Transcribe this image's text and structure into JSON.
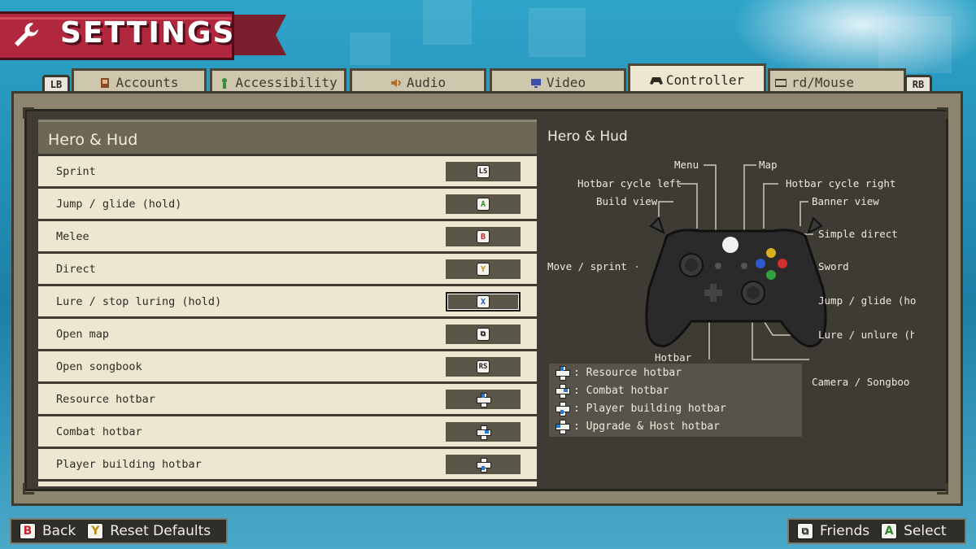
{
  "header": {
    "title": "SETTINGS"
  },
  "tabs": {
    "left_bumper": "LB",
    "right_bumper": "RB",
    "items": [
      {
        "label": "Accounts",
        "icon": "user-icon"
      },
      {
        "label": "Accessibility",
        "icon": "figure-icon"
      },
      {
        "label": "Audio",
        "icon": "speaker-icon"
      },
      {
        "label": "Video",
        "icon": "monitor-icon"
      },
      {
        "label": "Controller",
        "icon": "gamepad-icon",
        "active": true
      },
      {
        "label": "rd/Mouse",
        "icon": "keyboard-icon"
      }
    ]
  },
  "list": {
    "section_title": "Hero & Hud",
    "rows": [
      {
        "label": "Sprint",
        "key": "LS"
      },
      {
        "label": "Jump / glide (hold)",
        "key": "A"
      },
      {
        "label": "Melee",
        "key": "B"
      },
      {
        "label": "Direct",
        "key": "Y"
      },
      {
        "label": "Lure / stop luring (hold)",
        "key": "X",
        "selected": true
      },
      {
        "label": "Open map",
        "key": "view"
      },
      {
        "label": "Open songbook",
        "key": "RS"
      },
      {
        "label": "Resource hotbar",
        "key": "dpad-up"
      },
      {
        "label": "Combat hotbar",
        "key": "dpad-right"
      },
      {
        "label": "Player building hotbar",
        "key": "dpad-down"
      }
    ]
  },
  "diagram": {
    "title": "Hero & Hud",
    "labels": {
      "menu": "Menu",
      "map": "Map",
      "hotbar_left": "Hotbar cycle left",
      "hotbar_right": "Hotbar cycle right",
      "build_view": "Build view",
      "banner_view": "Banner view",
      "simple_direct": "Simple direct",
      "move": "Move / sprint (",
      "sword": "Sword",
      "jump": "Jump / glide (hol",
      "lure": "Lure / unlure (h",
      "hotbar": "Hotbar",
      "camera": "Camera / Songboo"
    },
    "legend": [
      {
        "text": ": Resource hotbar",
        "dir": "up"
      },
      {
        "text": ": Combat hotbar",
        "dir": "right"
      },
      {
        "text": ": Player building hotbar",
        "dir": "down"
      },
      {
        "text": ": Upgrade & Host hotbar",
        "dir": "left"
      }
    ]
  },
  "footer": {
    "back_key": "B",
    "back_label": "Back",
    "reset_key": "Y",
    "reset_label": "Reset Defaults",
    "friends_label": "Friends",
    "select_key": "A",
    "select_label": "Select"
  }
}
